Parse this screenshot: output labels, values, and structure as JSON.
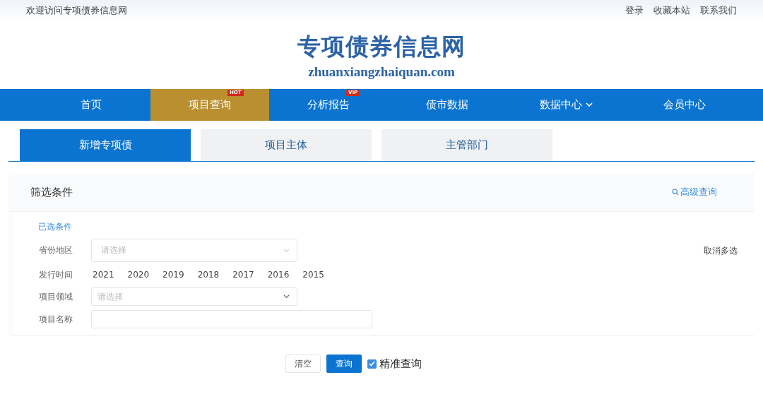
{
  "top_bar": {
    "welcome": "欢迎访问专项债券信息网",
    "links": [
      "登录",
      "收藏本站",
      "联系我们"
    ]
  },
  "logo": {
    "title": "专项债券信息网",
    "domain": "zhuanxiangzhaiquan.com"
  },
  "nav": [
    {
      "label": "首页",
      "selected": false
    },
    {
      "label": "项目查询",
      "selected": true,
      "badge": "HOT"
    },
    {
      "label": "分析报告",
      "selected": false,
      "badge": "VIP"
    },
    {
      "label": "债市数据",
      "selected": false
    },
    {
      "label": "数据中心",
      "selected": false,
      "dropdown": true
    },
    {
      "label": "会员中心",
      "selected": false
    }
  ],
  "tabs": [
    {
      "label": "新增专项债",
      "selected": true
    },
    {
      "label": "项目主体",
      "selected": false
    },
    {
      "label": "主管部门",
      "selected": false
    }
  ],
  "filter": {
    "title": "筛选条件",
    "advanced": "高级查询",
    "selected_label": "已选条件",
    "cancel_multi": "取消多选",
    "rows": [
      {
        "kind": "select",
        "label": "省份地区",
        "placeholder": "请选择"
      },
      {
        "kind": "years",
        "label": "发行时间",
        "options": [
          "2021",
          "2020",
          "2019",
          "2018",
          "2017",
          "2016",
          "2015"
        ]
      },
      {
        "kind": "select",
        "label": "项目领域",
        "placeholder": "请选择"
      },
      {
        "kind": "text",
        "label": "项目名称"
      }
    ]
  },
  "actions": {
    "clear": "清空",
    "search": "查询",
    "exact": {
      "label": "精准查询",
      "checked": true
    }
  }
}
